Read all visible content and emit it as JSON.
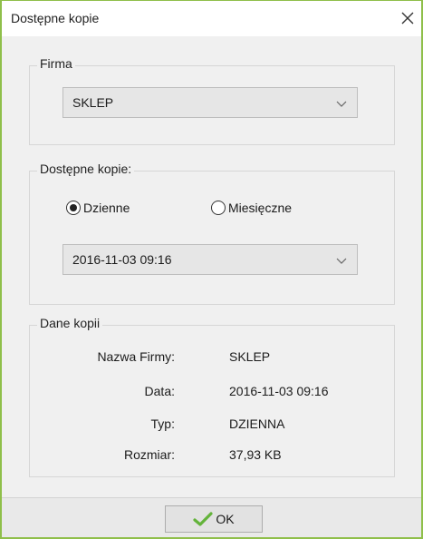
{
  "window": {
    "title": "Dostępne kopie"
  },
  "firma": {
    "legend": "Firma",
    "selected": "SKLEP"
  },
  "kopie": {
    "legend": "Dostępne kopie:",
    "radios": [
      {
        "label": "Dzienne",
        "checked": true
      },
      {
        "label": "Miesięczne",
        "checked": false
      }
    ],
    "selected": "2016-11-03 09:16"
  },
  "dane": {
    "legend": "Dane kopii",
    "rows": [
      {
        "label": "Nazwa Firmy:",
        "value": "SKLEP"
      },
      {
        "label": "Data:",
        "value": "2016-11-03 09:16"
      },
      {
        "label": "Typ:",
        "value": "DZIENNA"
      },
      {
        "label": "Rozmiar:",
        "value": "37,93 KB"
      }
    ]
  },
  "footer": {
    "ok_label": "OK"
  },
  "icons": {
    "close": "close-icon",
    "dropdown": "chevron-down-icon",
    "ok": "checkmark-icon"
  },
  "colors": {
    "accent_border": "#8fbf4a",
    "ok_check": "#63b33a"
  }
}
